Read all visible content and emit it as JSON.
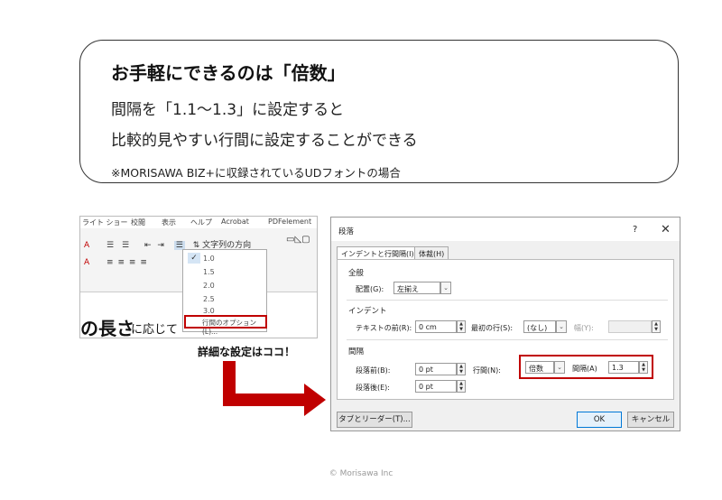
{
  "bubble": {
    "title": "お手軽にできるのは「倍数」",
    "line1": "間隔を「1.1〜1.3」に設定すると",
    "line2": "比較的見やすい行間に設定することができる",
    "note": "※MORISAWA BIZ+に収録されているUDフォントの場合"
  },
  "ribbon": {
    "menu": [
      "ライト ショー",
      "校閲",
      "表示",
      "ヘルプ",
      "Acrobat",
      "PDFelement"
    ],
    "text_direction": "文字列の方向",
    "doc_big": "の長さ",
    "doc_small": "に応じて"
  },
  "dropdown": {
    "items": [
      "1.0",
      "1.5",
      "2.0",
      "2.5",
      "3.0"
    ],
    "check": "✓",
    "options_label": "行間のオプション(L)..."
  },
  "caption": "詳細な設定はココ！",
  "dialog": {
    "title": "段落",
    "help": "?",
    "close": "✕",
    "tabs": [
      "インデントと行間隔(I)",
      "体裁(H)"
    ],
    "general": {
      "heading": "全般",
      "align_label": "配置(G):",
      "align_value": "左揃え"
    },
    "indent": {
      "heading": "インデント",
      "before_label": "テキストの前(R):",
      "before_value": "0 cm",
      "first_label": "最初の行(S):",
      "first_value": "(なし)",
      "width_label": "幅(Y):"
    },
    "spacing": {
      "heading": "間隔",
      "before_label": "段落前(B):",
      "before_value": "0 pt",
      "after_label": "段落後(E):",
      "after_value": "0 pt",
      "line_label": "行間(N):",
      "line_value": "倍数",
      "at_label": "間隔(A)",
      "at_value": "1.3"
    },
    "tabs_button": "タブとリーダー(T)...",
    "ok": "OK",
    "cancel": "キャンセル"
  },
  "copyright": "© Morisawa Inc",
  "colors": {
    "accent_red": "#c00000"
  }
}
